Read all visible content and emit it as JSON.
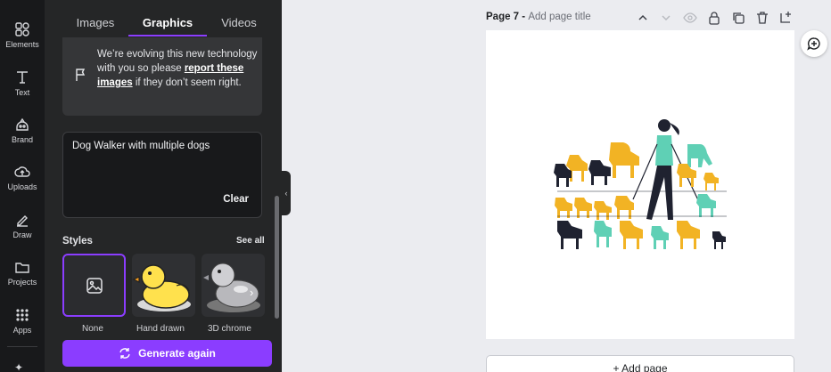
{
  "rail": {
    "items": [
      {
        "label": "Elements",
        "icon": "elements-icon"
      },
      {
        "label": "Text",
        "icon": "text-icon"
      },
      {
        "label": "Brand",
        "icon": "brand-icon"
      },
      {
        "label": "Uploads",
        "icon": "uploads-icon"
      },
      {
        "label": "Draw",
        "icon": "draw-icon"
      },
      {
        "label": "Projects",
        "icon": "projects-icon"
      },
      {
        "label": "Apps",
        "icon": "apps-icon"
      }
    ]
  },
  "panel": {
    "tabs": [
      {
        "label": "Images"
      },
      {
        "label": "Graphics",
        "active": true
      },
      {
        "label": "Videos"
      }
    ],
    "notice": {
      "text_before": "We’re evolving this new technology with you so please ",
      "link": "report these images",
      "text_after": " if they don’t seem right."
    },
    "prompt": {
      "value": "Dog Walker with multiple dogs",
      "clear_label": "Clear"
    },
    "styles": {
      "heading": "Styles",
      "see_all": "See all",
      "cards": [
        {
          "label": "None",
          "selected": true
        },
        {
          "label": "Hand drawn"
        },
        {
          "label": "3D chrome"
        }
      ]
    },
    "generate_label": "Generate again"
  },
  "canvas": {
    "page_number": "Page 7 - ",
    "page_title_placeholder": "Add page title",
    "add_page_label": "+ Add page"
  },
  "colors": {
    "accent": "#8b3dff",
    "dog_yellow": "#f2b324",
    "dog_teal": "#5fd0b5",
    "dog_black": "#1f2230"
  }
}
